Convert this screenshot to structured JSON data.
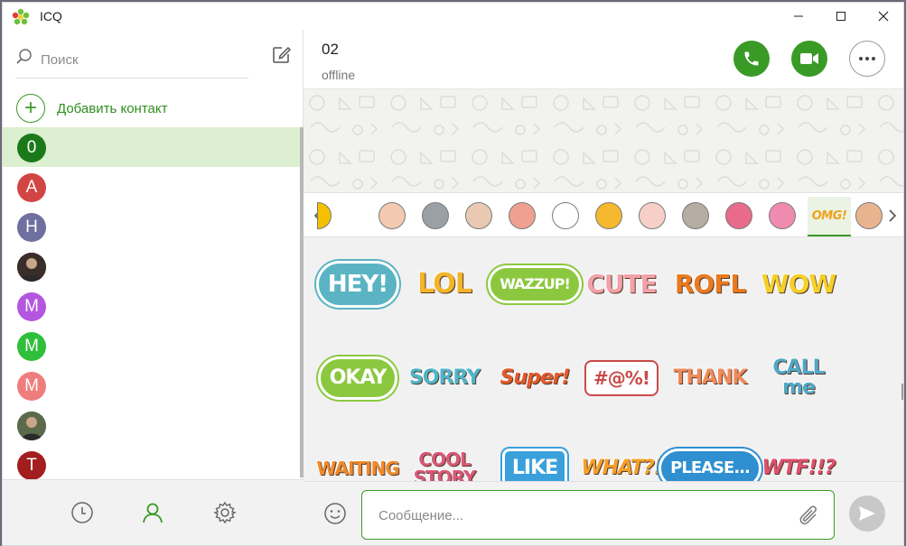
{
  "app": {
    "title": "ICQ"
  },
  "colors": {
    "brand_green": "#3a9a26",
    "active_row": "#dcefd0"
  },
  "sidebar": {
    "search_placeholder": "Поиск",
    "add_contact_label": "Добавить контакт",
    "contacts": [
      {
        "initial": "0",
        "color": "#1a7a1a",
        "active": true
      },
      {
        "initial": "A",
        "color": "#d24545",
        "active": false
      },
      {
        "initial": "H",
        "color": "#6f6fa0",
        "active": false
      },
      {
        "initial": "",
        "color": "#3a2e2a",
        "photo": true,
        "active": false
      },
      {
        "initial": "M",
        "color": "#b456e0",
        "active": false
      },
      {
        "initial": "M",
        "color": "#2fbf3a",
        "active": false
      },
      {
        "initial": "M",
        "color": "#ef7d7d",
        "active": false
      },
      {
        "initial": "",
        "color": "#5b6a4a",
        "photo": true,
        "active": false
      },
      {
        "initial": "T",
        "color": "#a31e1e",
        "active": false
      }
    ],
    "footer_icons": [
      "clock-icon",
      "contacts-icon",
      "settings-icon"
    ]
  },
  "chat": {
    "name": "02",
    "status": "offline",
    "message_placeholder": "Сообщение..."
  },
  "stickers": {
    "pack_icons": [
      "partial-pack",
      "girl-face",
      "grumpy-cat",
      "pig",
      "cowboy",
      "ghost",
      "yellow-cat",
      "bunny",
      "gray-cat",
      "bird-girl",
      "gift",
      "omg",
      "couple"
    ],
    "active_pack_label": "OMG!",
    "rows": [
      [
        "HEY!",
        "LOL",
        "WAZZUP!",
        "CUTE",
        "ROFL",
        "WOW"
      ],
      [
        "OKAY",
        "SORRY",
        "Super!",
        "#@%!",
        "THANK",
        "CALL me"
      ],
      [
        "WAITING",
        "COOL STORY",
        "LIKE",
        "WHAT?!",
        "PLEASE...",
        "WTF!!?"
      ]
    ]
  }
}
